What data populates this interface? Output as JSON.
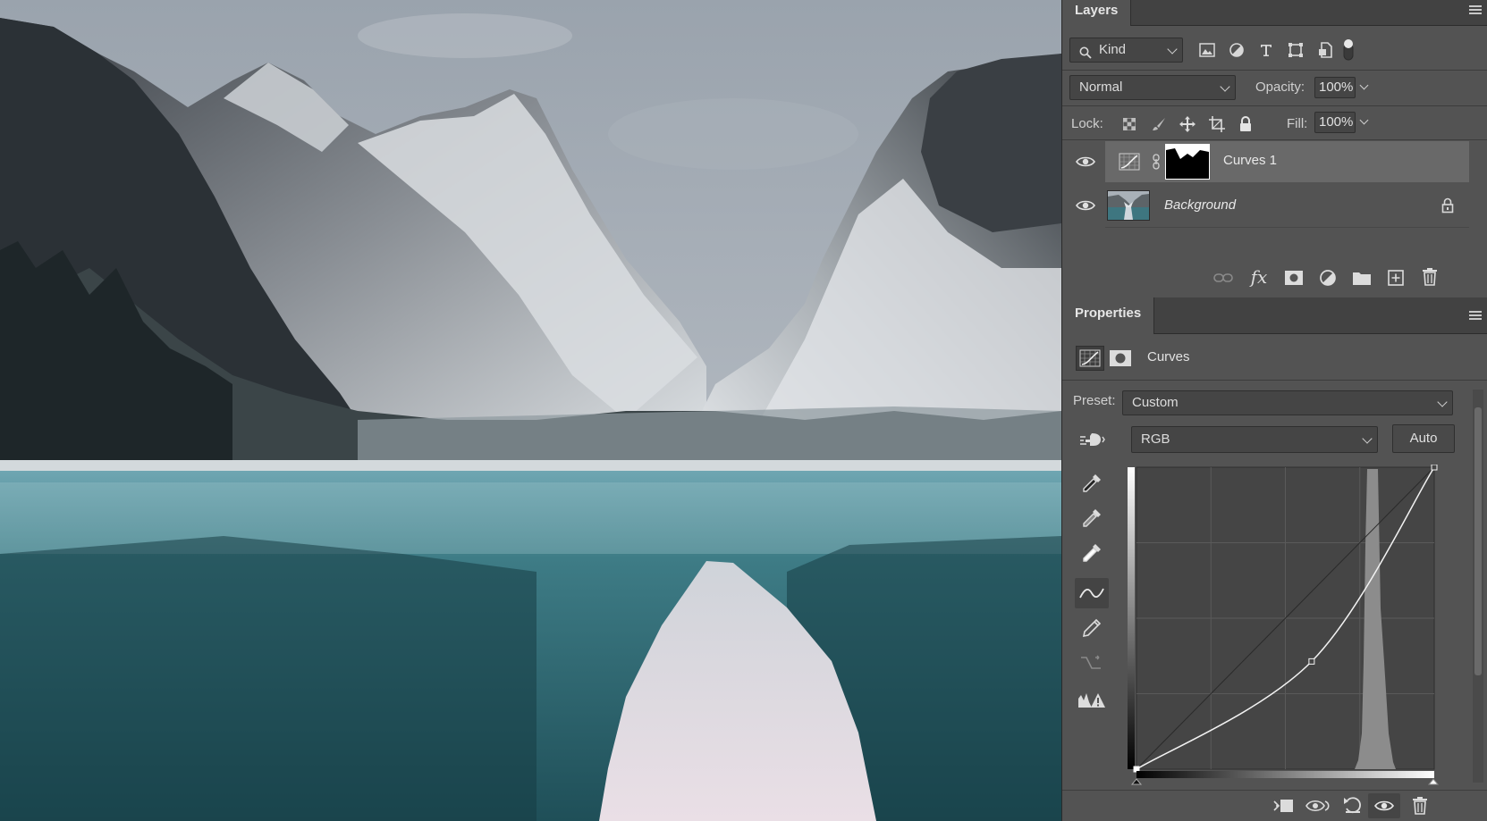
{
  "layers_panel": {
    "tab_label": "Layers",
    "filter": {
      "kind_label": "Kind"
    },
    "blend_mode": "Normal",
    "opacity_label": "Opacity:",
    "opacity_value": "100%",
    "lock_label": "Lock:",
    "fill_label": "Fill:",
    "fill_value": "100%",
    "layers": [
      {
        "name": "Curves 1",
        "selected": true,
        "visible": true,
        "type": "curves-adjustment"
      },
      {
        "name": "Background",
        "selected": false,
        "visible": true,
        "type": "image",
        "locked": true
      }
    ]
  },
  "properties_panel": {
    "tab_label": "Properties",
    "adjustment_name": "Curves",
    "preset_label": "Preset:",
    "preset_value": "Custom",
    "channel_value": "RGB",
    "auto_label": "Auto",
    "curve": {
      "points": [
        [
          0,
          0
        ],
        [
          150,
          91
        ],
        [
          255,
          255
        ]
      ]
    }
  },
  "colors": {
    "panel_bg": "#535353",
    "panel_dark": "#424242",
    "selected_row": "#696969",
    "graph_bg": "#454545"
  }
}
